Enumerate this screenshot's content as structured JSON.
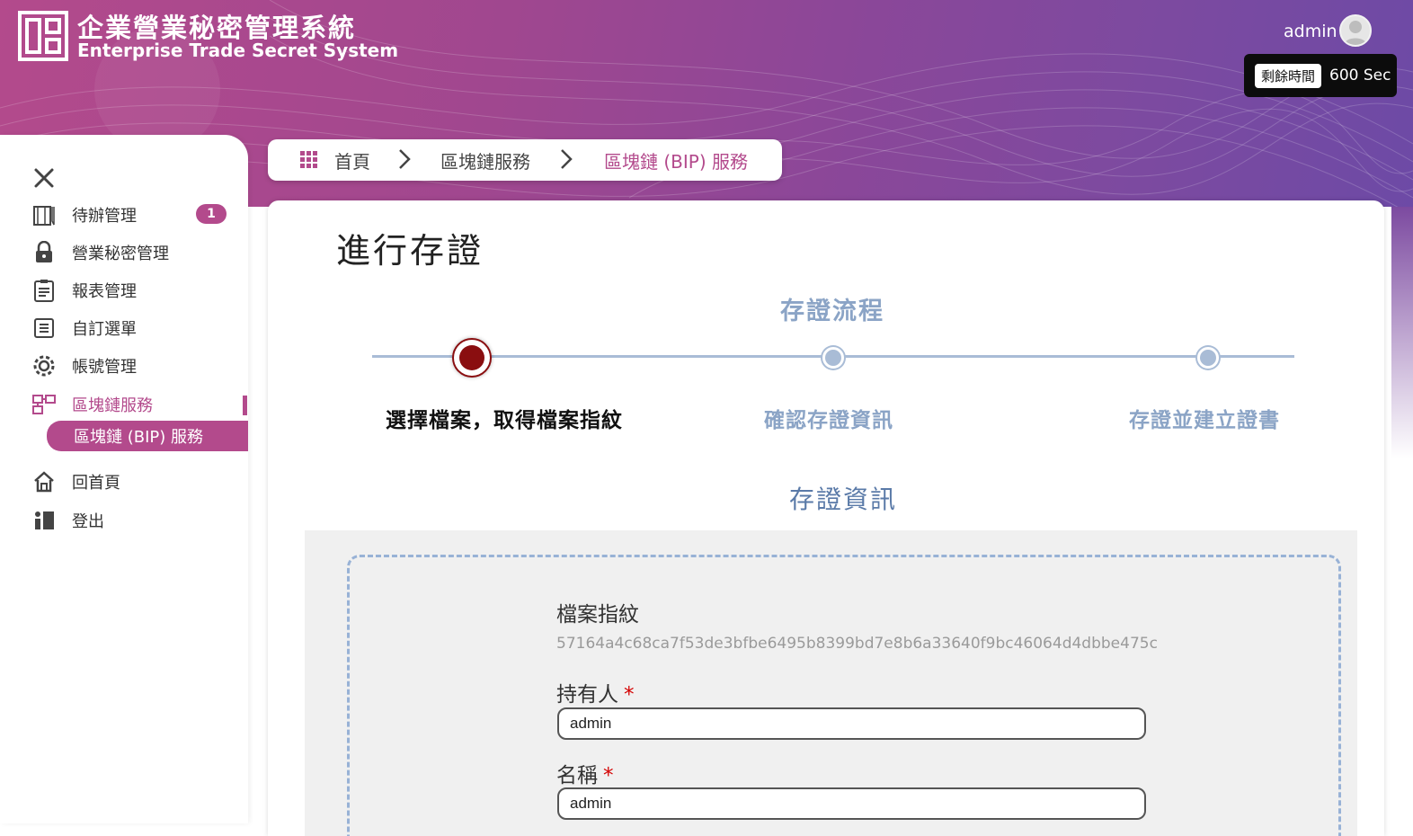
{
  "app": {
    "title": "企業營業秘密管理系統",
    "subtitle": "Enterprise Trade Secret System"
  },
  "user": {
    "name": "admin",
    "timer_label": "剩餘時間",
    "timer_value": "600 Sec"
  },
  "sidebar": {
    "items": [
      {
        "label": "待辦管理",
        "icon": "clipboard-todo-icon",
        "badge": "1"
      },
      {
        "label": "營業秘密管理",
        "icon": "lock-icon"
      },
      {
        "label": "報表管理",
        "icon": "report-icon"
      },
      {
        "label": "自訂選單",
        "icon": "list-icon"
      },
      {
        "label": "帳號管理",
        "icon": "gear-icon"
      },
      {
        "label": "區塊鏈服務",
        "icon": "blockchain-icon",
        "active": true
      },
      {
        "label": "區塊鏈 (BIP) 服務",
        "sub": true
      },
      {
        "label": "回首頁",
        "icon": "home-icon"
      },
      {
        "label": "登出",
        "icon": "logout-icon"
      }
    ]
  },
  "breadcrumb": {
    "home": "首頁",
    "middle": "區塊鏈服務",
    "current": "區塊鏈 (BIP) 服務"
  },
  "main": {
    "title": "進行存證",
    "flow_title": "存證流程",
    "steps": [
      "選擇檔案，取得檔案指紋",
      "確認存證資訊",
      "存證並建立證書"
    ],
    "current_step": 1,
    "info_title": "存證資訊",
    "fields": {
      "fingerprint_label": "檔案指紋",
      "fingerprint_value": "57164a4c68ca7f53de3bfbe6495b8399bd7e8b6a33640f9bc46064d4dbbe475c",
      "owner_label": "持有人",
      "owner_value": "admin",
      "name_label": "名稱",
      "name_value": "admin",
      "required_mark": "*"
    }
  },
  "colors": {
    "brand": "#b34a8c",
    "step_active": "#8a0e10",
    "step_inactive": "#a9bcd6",
    "required": "#d40000"
  }
}
